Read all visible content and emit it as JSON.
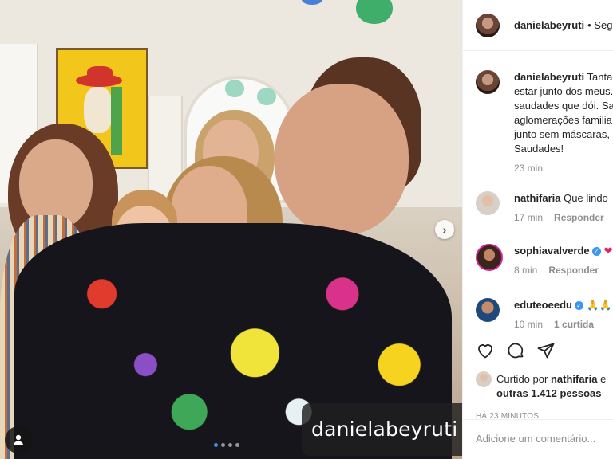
{
  "photo": {
    "watermark": "danielabeyruti",
    "carousel_total": 4,
    "carousel_active": 1
  },
  "header": {
    "username": "danielabeyruti",
    "follow": "• Seguir"
  },
  "caption": {
    "username": "danielabeyruti",
    "lines": [
      "Tanta felicidade",
      "estar junto dos meus.",
      "saudades que dói. Sa",
      "aglomerações familia",
      "junto sem máscaras,",
      "Saudades!"
    ],
    "time": "23 min"
  },
  "comments": [
    {
      "username": "nathifaria",
      "text": "Que lindo",
      "time": "17 min",
      "reply": "Responder",
      "verified": false,
      "emoji": ""
    },
    {
      "username": "sophiavalverde",
      "text": "",
      "time": "8 min",
      "reply": "Responder",
      "verified": true,
      "emoji": "❤"
    },
    {
      "username": "eduteoeedu",
      "text": "",
      "time": "10 min",
      "reply": "1 curtida",
      "verified": true,
      "emoji": "🙏🙏"
    }
  ],
  "actions": {
    "liked_prefix": "Curtido por",
    "liked_user": "nathifaria",
    "liked_suffix": "e",
    "liked_others": "outras 1.412 pessoas",
    "time_ago": "HÁ 23 MINUTOS"
  },
  "add_comment": {
    "placeholder": "Adicione um comentário..."
  },
  "colors": {
    "accent_blue": "#3897f0",
    "text": "#262626",
    "muted": "#8e8e8e",
    "heart": "#e0245e"
  }
}
